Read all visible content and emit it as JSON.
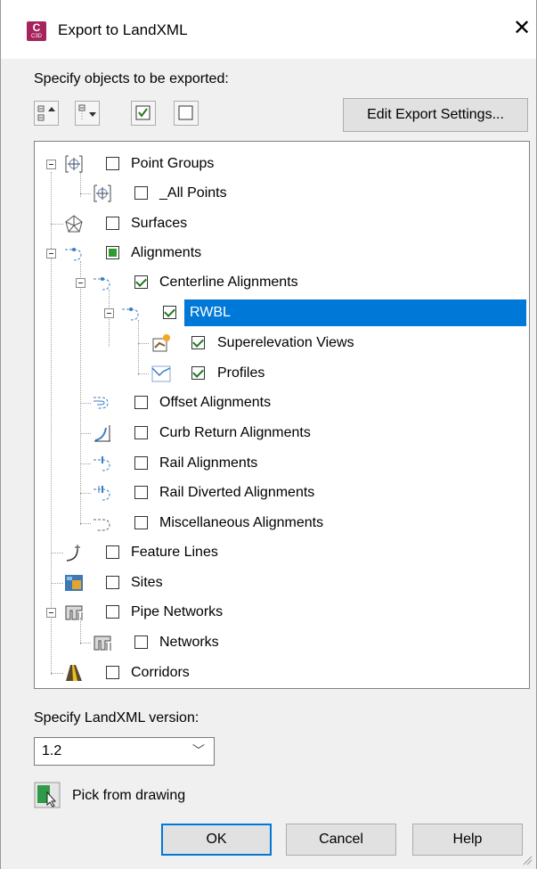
{
  "window": {
    "app_icon_text": "C",
    "app_icon_sub": "C3D",
    "title": "Export to LandXML",
    "close_glyph": "✕"
  },
  "objects_label": "Specify objects to be exported:",
  "toolbar": {
    "expand_all": "expand-all-icon",
    "collapse_all": "collapse-all-icon",
    "check_all": "check-all-icon",
    "uncheck_all": "uncheck-all-icon",
    "edit_export_settings": "Edit Export Settings..."
  },
  "tree": {
    "point_groups": "Point Groups",
    "all_points": "_All Points",
    "surfaces": "Surfaces",
    "alignments": "Alignments",
    "centerline_alignments": "Centerline Alignments",
    "rwbl": "RWBL",
    "superelevation_views": "Superelevation Views",
    "profiles": "Profiles",
    "offset_alignments": "Offset Alignments",
    "curb_return_alignments": "Curb Return Alignments",
    "rail_alignments": "Rail Alignments",
    "rail_diverted_alignments": "Rail Diverted Alignments",
    "miscellaneous_alignments": "Miscellaneous Alignments",
    "feature_lines": "Feature Lines",
    "sites": "Sites",
    "pipe_networks": "Pipe Networks",
    "networks": "Networks",
    "corridors": "Corridors"
  },
  "version_label": "Specify LandXML version:",
  "version": {
    "selected": "1.2",
    "chevron": "﹀"
  },
  "pick_label": "Pick from drawing",
  "buttons": {
    "ok": "OK",
    "cancel": "Cancel",
    "help": "Help"
  },
  "colors": {
    "selection": "#0078d7",
    "check": "#1e7a1e",
    "app_icon": "#a5245c"
  }
}
